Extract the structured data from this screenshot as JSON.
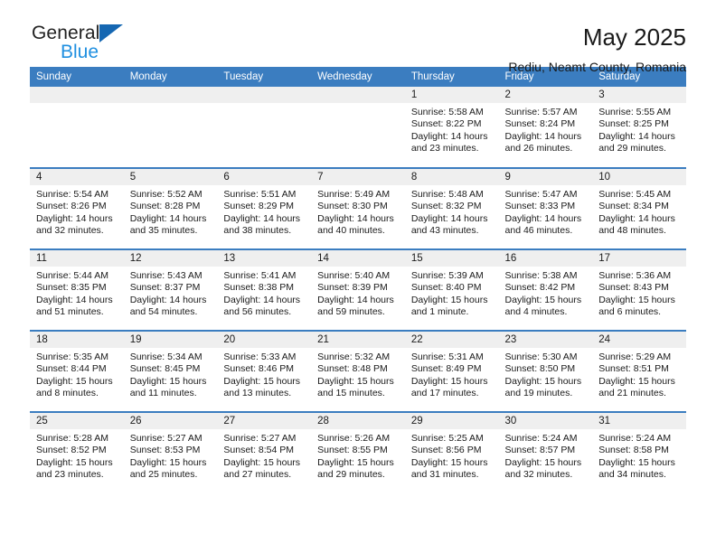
{
  "brand": {
    "name_part1": "General",
    "name_part2": "Blue",
    "triangle_color": "#1567b2",
    "blue_text_color": "#1f8fe0"
  },
  "header": {
    "title": "May 2025",
    "location": "Rediu, Neamt County, Romania"
  },
  "theme": {
    "header_bar_color": "#3b7dc0",
    "daynum_band_color": "#efefef",
    "row_divider_color": "#3b7dc0"
  },
  "weekdays": [
    "Sunday",
    "Monday",
    "Tuesday",
    "Wednesday",
    "Thursday",
    "Friday",
    "Saturday"
  ],
  "labels": {
    "sunrise_prefix": "Sunrise:",
    "sunset_prefix": "Sunset:",
    "daylight_prefix": "Daylight:"
  },
  "weeks": [
    [
      {
        "day": "",
        "empty": true
      },
      {
        "day": "",
        "empty": true
      },
      {
        "day": "",
        "empty": true
      },
      {
        "day": "",
        "empty": true
      },
      {
        "day": "1",
        "sunrise": "Sunrise: 5:58 AM",
        "sunset": "Sunset: 8:22 PM",
        "daylight": "Daylight: 14 hours and 23 minutes."
      },
      {
        "day": "2",
        "sunrise": "Sunrise: 5:57 AM",
        "sunset": "Sunset: 8:24 PM",
        "daylight": "Daylight: 14 hours and 26 minutes."
      },
      {
        "day": "3",
        "sunrise": "Sunrise: 5:55 AM",
        "sunset": "Sunset: 8:25 PM",
        "daylight": "Daylight: 14 hours and 29 minutes."
      }
    ],
    [
      {
        "day": "4",
        "sunrise": "Sunrise: 5:54 AM",
        "sunset": "Sunset: 8:26 PM",
        "daylight": "Daylight: 14 hours and 32 minutes."
      },
      {
        "day": "5",
        "sunrise": "Sunrise: 5:52 AM",
        "sunset": "Sunset: 8:28 PM",
        "daylight": "Daylight: 14 hours and 35 minutes."
      },
      {
        "day": "6",
        "sunrise": "Sunrise: 5:51 AM",
        "sunset": "Sunset: 8:29 PM",
        "daylight": "Daylight: 14 hours and 38 minutes."
      },
      {
        "day": "7",
        "sunrise": "Sunrise: 5:49 AM",
        "sunset": "Sunset: 8:30 PM",
        "daylight": "Daylight: 14 hours and 40 minutes."
      },
      {
        "day": "8",
        "sunrise": "Sunrise: 5:48 AM",
        "sunset": "Sunset: 8:32 PM",
        "daylight": "Daylight: 14 hours and 43 minutes."
      },
      {
        "day": "9",
        "sunrise": "Sunrise: 5:47 AM",
        "sunset": "Sunset: 8:33 PM",
        "daylight": "Daylight: 14 hours and 46 minutes."
      },
      {
        "day": "10",
        "sunrise": "Sunrise: 5:45 AM",
        "sunset": "Sunset: 8:34 PM",
        "daylight": "Daylight: 14 hours and 48 minutes."
      }
    ],
    [
      {
        "day": "11",
        "sunrise": "Sunrise: 5:44 AM",
        "sunset": "Sunset: 8:35 PM",
        "daylight": "Daylight: 14 hours and 51 minutes."
      },
      {
        "day": "12",
        "sunrise": "Sunrise: 5:43 AM",
        "sunset": "Sunset: 8:37 PM",
        "daylight": "Daylight: 14 hours and 54 minutes."
      },
      {
        "day": "13",
        "sunrise": "Sunrise: 5:41 AM",
        "sunset": "Sunset: 8:38 PM",
        "daylight": "Daylight: 14 hours and 56 minutes."
      },
      {
        "day": "14",
        "sunrise": "Sunrise: 5:40 AM",
        "sunset": "Sunset: 8:39 PM",
        "daylight": "Daylight: 14 hours and 59 minutes."
      },
      {
        "day": "15",
        "sunrise": "Sunrise: 5:39 AM",
        "sunset": "Sunset: 8:40 PM",
        "daylight": "Daylight: 15 hours and 1 minute."
      },
      {
        "day": "16",
        "sunrise": "Sunrise: 5:38 AM",
        "sunset": "Sunset: 8:42 PM",
        "daylight": "Daylight: 15 hours and 4 minutes."
      },
      {
        "day": "17",
        "sunrise": "Sunrise: 5:36 AM",
        "sunset": "Sunset: 8:43 PM",
        "daylight": "Daylight: 15 hours and 6 minutes."
      }
    ],
    [
      {
        "day": "18",
        "sunrise": "Sunrise: 5:35 AM",
        "sunset": "Sunset: 8:44 PM",
        "daylight": "Daylight: 15 hours and 8 minutes."
      },
      {
        "day": "19",
        "sunrise": "Sunrise: 5:34 AM",
        "sunset": "Sunset: 8:45 PM",
        "daylight": "Daylight: 15 hours and 11 minutes."
      },
      {
        "day": "20",
        "sunrise": "Sunrise: 5:33 AM",
        "sunset": "Sunset: 8:46 PM",
        "daylight": "Daylight: 15 hours and 13 minutes."
      },
      {
        "day": "21",
        "sunrise": "Sunrise: 5:32 AM",
        "sunset": "Sunset: 8:48 PM",
        "daylight": "Daylight: 15 hours and 15 minutes."
      },
      {
        "day": "22",
        "sunrise": "Sunrise: 5:31 AM",
        "sunset": "Sunset: 8:49 PM",
        "daylight": "Daylight: 15 hours and 17 minutes."
      },
      {
        "day": "23",
        "sunrise": "Sunrise: 5:30 AM",
        "sunset": "Sunset: 8:50 PM",
        "daylight": "Daylight: 15 hours and 19 minutes."
      },
      {
        "day": "24",
        "sunrise": "Sunrise: 5:29 AM",
        "sunset": "Sunset: 8:51 PM",
        "daylight": "Daylight: 15 hours and 21 minutes."
      }
    ],
    [
      {
        "day": "25",
        "sunrise": "Sunrise: 5:28 AM",
        "sunset": "Sunset: 8:52 PM",
        "daylight": "Daylight: 15 hours and 23 minutes."
      },
      {
        "day": "26",
        "sunrise": "Sunrise: 5:27 AM",
        "sunset": "Sunset: 8:53 PM",
        "daylight": "Daylight: 15 hours and 25 minutes."
      },
      {
        "day": "27",
        "sunrise": "Sunrise: 5:27 AM",
        "sunset": "Sunset: 8:54 PM",
        "daylight": "Daylight: 15 hours and 27 minutes."
      },
      {
        "day": "28",
        "sunrise": "Sunrise: 5:26 AM",
        "sunset": "Sunset: 8:55 PM",
        "daylight": "Daylight: 15 hours and 29 minutes."
      },
      {
        "day": "29",
        "sunrise": "Sunrise: 5:25 AM",
        "sunset": "Sunset: 8:56 PM",
        "daylight": "Daylight: 15 hours and 31 minutes."
      },
      {
        "day": "30",
        "sunrise": "Sunrise: 5:24 AM",
        "sunset": "Sunset: 8:57 PM",
        "daylight": "Daylight: 15 hours and 32 minutes."
      },
      {
        "day": "31",
        "sunrise": "Sunrise: 5:24 AM",
        "sunset": "Sunset: 8:58 PM",
        "daylight": "Daylight: 15 hours and 34 minutes."
      }
    ]
  ]
}
